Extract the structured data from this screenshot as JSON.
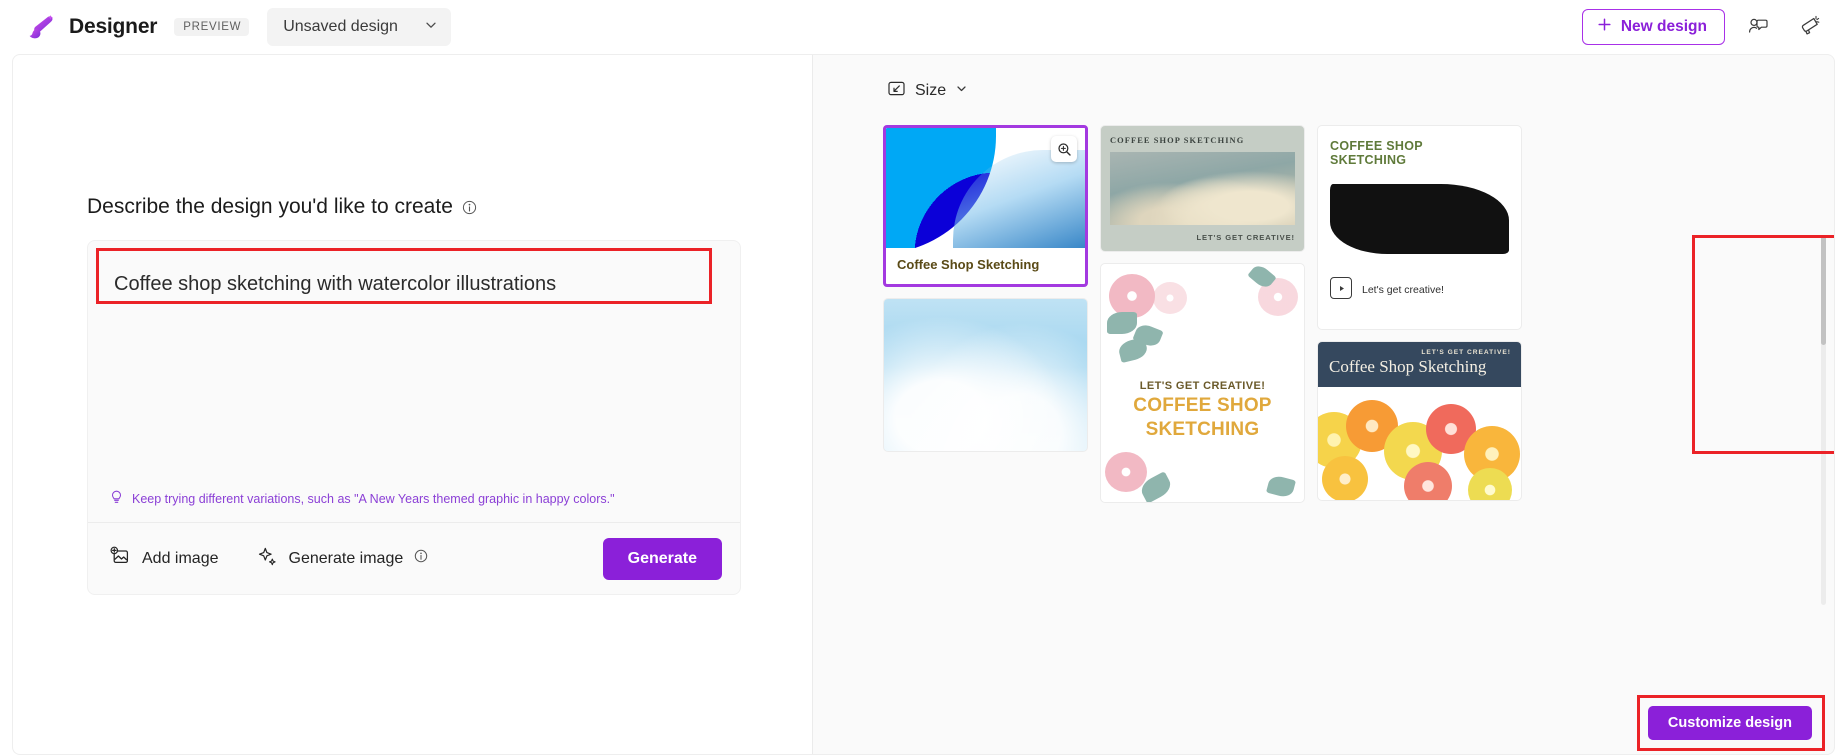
{
  "header": {
    "logo_icon": "designer-brush-logo",
    "brand": "Designer",
    "preview_badge": "PREVIEW",
    "document_name": "Unsaved design",
    "document_chevron_icon": "chevron-down-icon",
    "new_design_label": "New design",
    "new_design_plus_icon": "plus-icon",
    "feedback_icon": "person-feedback-icon",
    "announcement_icon": "megaphone-icon"
  },
  "left_panel": {
    "heading": "Describe the design you'd like to create",
    "heading_info_icon": "info-icon",
    "prompt_value": "Coffee shop sketching with watercolor illustrations",
    "prompt_placeholder": "Describe the design you'd like to create",
    "hint_icon": "lightbulb-icon",
    "hint_text": "Keep trying different variations, such as \"A New Years themed graphic in happy colors.\"",
    "add_image_label": "Add image",
    "add_image_icon": "image-add-icon",
    "generate_image_label": "Generate image",
    "generate_image_icon": "sparkle-icon",
    "generate_image_info_icon": "info-icon",
    "generate_label": "Generate"
  },
  "right_panel": {
    "size_label": "Size",
    "size_icon": "resize-icon",
    "size_chevron_icon": "chevron-down-icon",
    "zoom_badge_icon": "magnifier-zoom-in-icon",
    "customize_label": "Customize design",
    "cards": [
      {
        "id": "card-blue-arc",
        "selected": true,
        "caption": "Coffee Shop Sketching"
      },
      {
        "id": "card-sky-watercolor",
        "selected": false,
        "caption": ""
      },
      {
        "id": "card-vintage-clouds",
        "selected": false,
        "title": "COFFEE SHOP SKETCHING",
        "subtitle": "LET'S GET CREATIVE!"
      },
      {
        "id": "card-floral",
        "selected": false,
        "title": "LET'S GET CREATIVE!",
        "headline_line1": "COFFEE SHOP",
        "headline_line2": "SKETCHING"
      },
      {
        "id": "card-black-brush",
        "selected": false,
        "title_line1": "COFFEE SHOP",
        "title_line2": "SKETCHING",
        "caption": "Let's get creative!",
        "play_icon": "video-play-icon"
      },
      {
        "id": "card-citrus",
        "selected": false,
        "kicker": "LET'S GET CREATIVE!",
        "title": "Coffee Shop Sketching"
      }
    ]
  },
  "annotations": {
    "prompt_box_color": "#eb2227",
    "selected_card_color": "#eb2227",
    "customize_box_color": "#eb2227"
  },
  "colors": {
    "brand_purple": "#8b20d9",
    "accent_outline": "#a830e8",
    "hint_purple": "#8b3fd6",
    "annotation_red": "#eb2227"
  }
}
